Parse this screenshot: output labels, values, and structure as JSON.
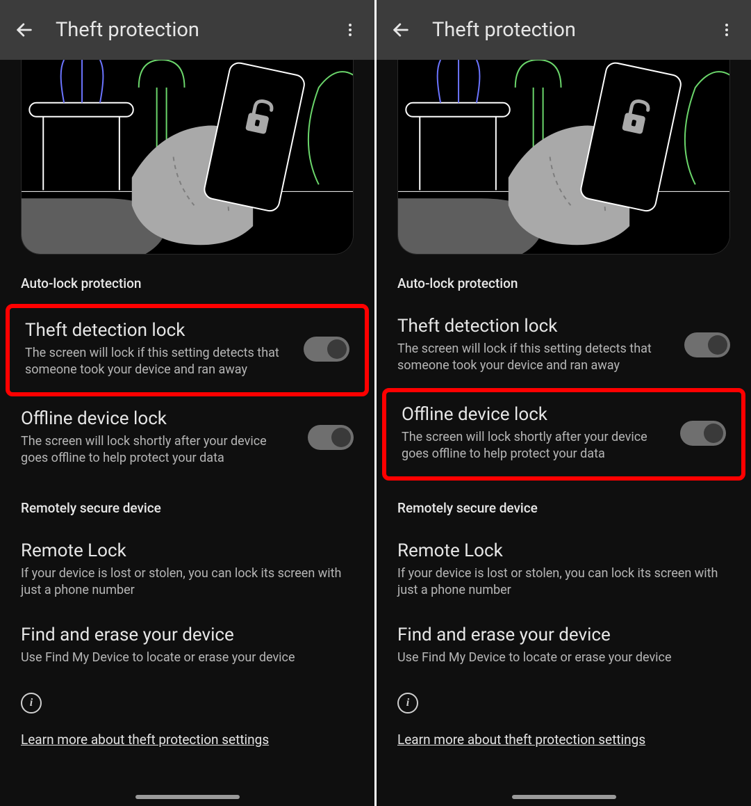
{
  "panes": [
    {
      "header": {
        "title": "Theft protection"
      },
      "section1": "Auto-lock protection",
      "items1": [
        {
          "title": "Theft detection lock",
          "desc": "The screen will lock if this setting detects that someone took your device and ran away",
          "toggle": true,
          "highlighted": true
        },
        {
          "title": "Offline device lock",
          "desc": "The screen will lock shortly after your device goes offline to help protect your data",
          "toggle": true,
          "highlighted": false
        }
      ],
      "section2": "Remotely secure device",
      "items2": [
        {
          "title": "Remote Lock",
          "desc": "If your device is lost or stolen, you can lock its screen with just a phone number"
        },
        {
          "title": "Find and erase your device",
          "desc": "Use Find My Device to locate or erase your device"
        }
      ],
      "learn": "Learn more about theft protection settings"
    },
    {
      "header": {
        "title": "Theft protection"
      },
      "section1": "Auto-lock protection",
      "items1": [
        {
          "title": "Theft detection lock",
          "desc": "The screen will lock if this setting detects that someone took your device and ran away",
          "toggle": true,
          "highlighted": false
        },
        {
          "title": "Offline device lock",
          "desc": "The screen will lock shortly after your device goes offline to help protect your data",
          "toggle": true,
          "highlighted": true
        }
      ],
      "section2": "Remotely secure device",
      "items2": [
        {
          "title": "Remote Lock",
          "desc": "If your device is lost or stolen, you can lock its screen with just a phone number"
        },
        {
          "title": "Find and erase your device",
          "desc": "Use Find My Device to locate or erase your device"
        }
      ],
      "learn": "Learn more about theft protection settings"
    }
  ]
}
